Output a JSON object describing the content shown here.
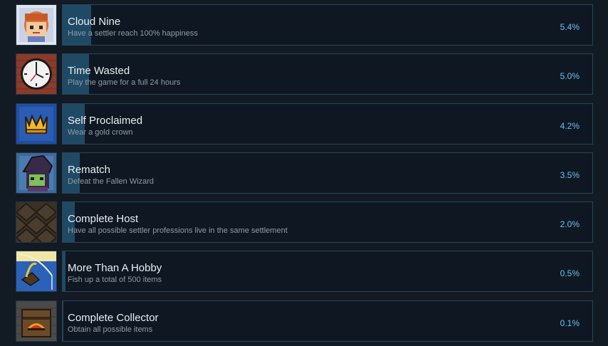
{
  "achievements": [
    {
      "title": "Cloud Nine",
      "description": "Have a settler reach 100% happiness",
      "percent_label": "5.4%",
      "percent": 5.4,
      "icon": "happy-settler-icon"
    },
    {
      "title": "Time Wasted",
      "description": "Play the game for a full 24 hours",
      "percent_label": "5.0%",
      "percent": 5.0,
      "icon": "clock-icon"
    },
    {
      "title": "Self Proclaimed",
      "description": "Wear a gold crown",
      "percent_label": "4.2%",
      "percent": 4.2,
      "icon": "gold-crown-icon"
    },
    {
      "title": "Rematch",
      "description": "Defeat the Fallen Wizard",
      "percent_label": "3.5%",
      "percent": 3.5,
      "icon": "fallen-wizard-icon"
    },
    {
      "title": "Complete Host",
      "description": "Have all possible settler professions live in the same settlement",
      "percent_label": "2.0%",
      "percent": 2.0,
      "icon": "settlement-roofs-icon"
    },
    {
      "title": "More Than A Hobby",
      "description": "Fish up a total of 500 items",
      "percent_label": "0.5%",
      "percent": 0.5,
      "icon": "fishing-icon"
    },
    {
      "title": "Complete Collector",
      "description": "Obtain all possible items",
      "percent_label": "0.1%",
      "percent": 0.1,
      "icon": "treasure-chest-icon"
    }
  ]
}
